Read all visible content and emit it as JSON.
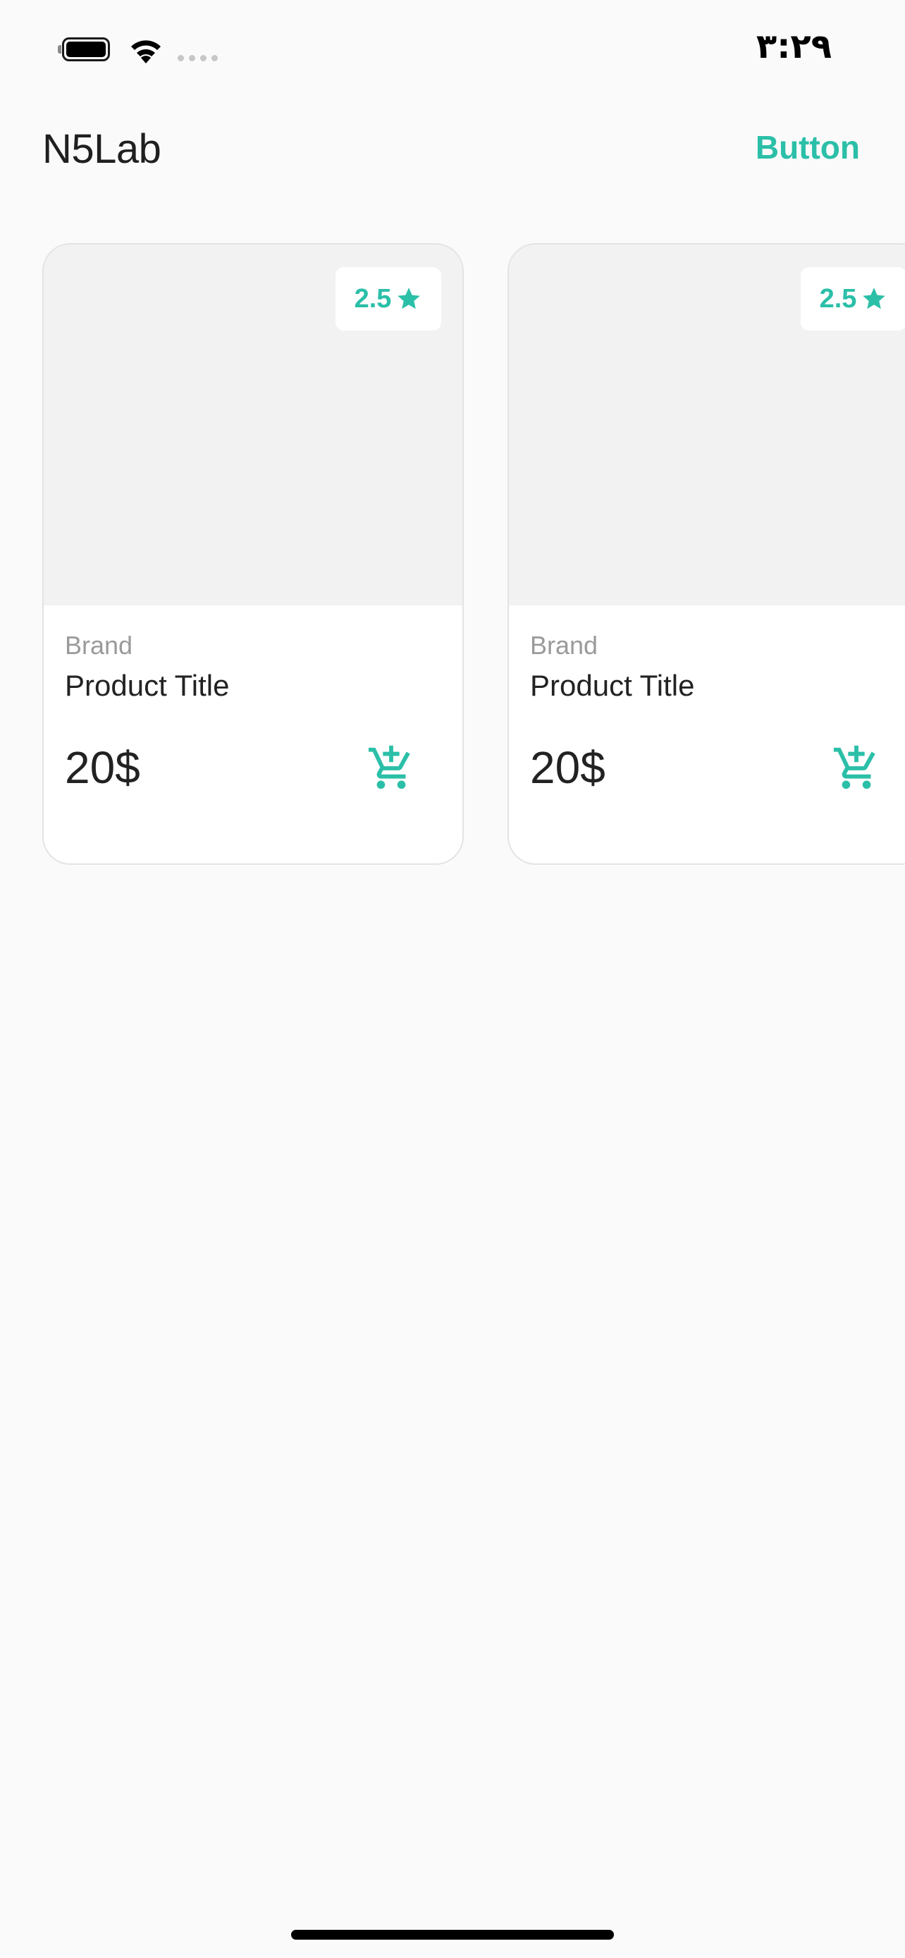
{
  "status_bar": {
    "time": "۳:۲۹",
    "icons": [
      "battery-icon",
      "wifi-icon",
      "signal-dots-icon"
    ]
  },
  "header": {
    "title": "N5Lab",
    "button_label": "Button"
  },
  "products": [
    {
      "rating": "2.5",
      "brand": "Brand",
      "title": "Product Title",
      "price": "20$",
      "icon_rating": "star-icon",
      "icon_cart": "add-to-cart-icon"
    },
    {
      "rating": "2.5",
      "brand": "Brand",
      "title": "Product Title",
      "price": "20$",
      "icon_rating": "star-icon",
      "icon_cart": "add-to-cart-icon"
    }
  ],
  "colors": {
    "accent": "#2bbfa8",
    "background": "#fafafa",
    "card_image": "#f2f2f2",
    "text_primary": "#222222",
    "text_secondary": "#9a9a9a"
  }
}
